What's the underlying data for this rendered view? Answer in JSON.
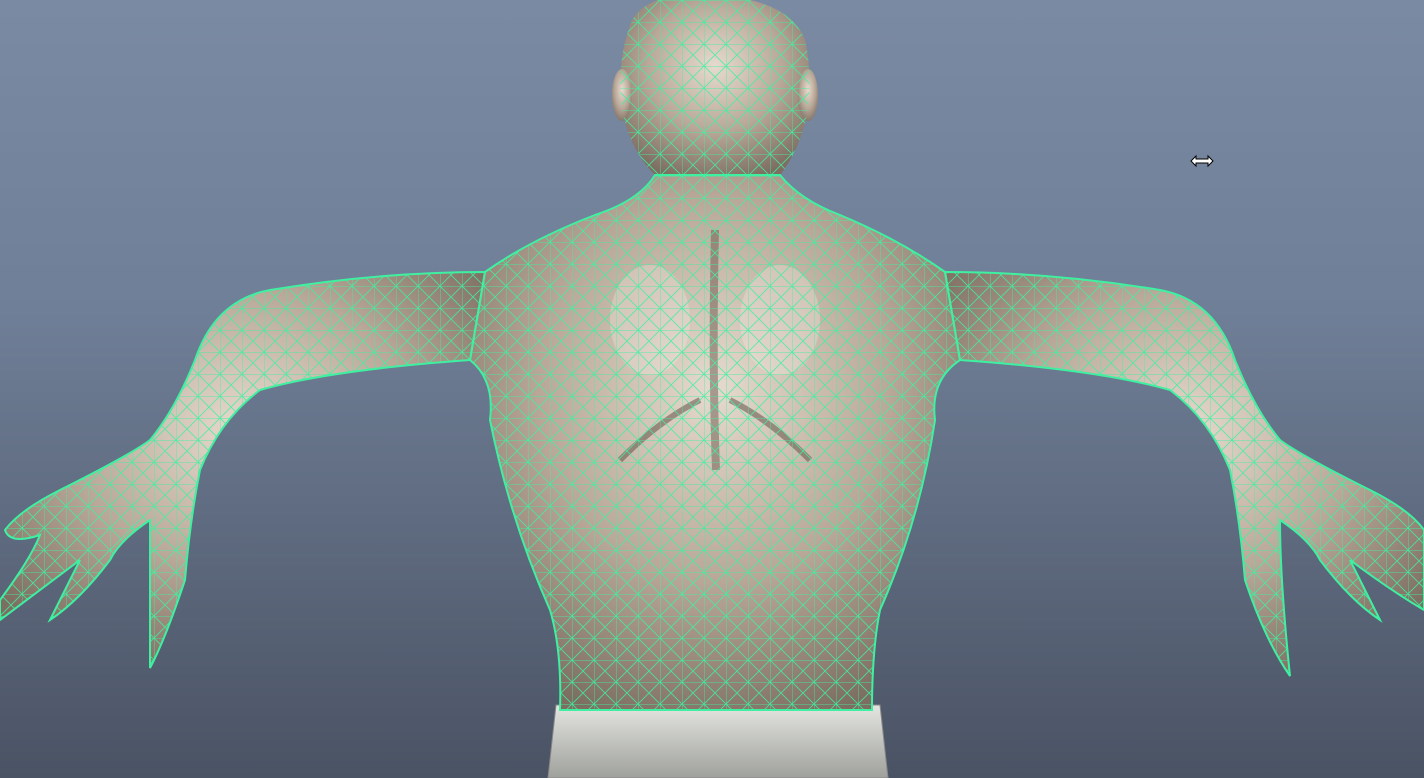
{
  "viewport": {
    "background_top": "#7b8aa3",
    "background_bottom": "#4a5364",
    "wireframe_color": "#3ff0a0",
    "skin_color": "#c9b8a6",
    "pants_color": "#cfd0cc"
  },
  "model": {
    "icon": "character-mesh-icon",
    "display_mode": "wireframe-on-shaded",
    "selected": true
  },
  "cursor": {
    "icon": "resize-horizontal-cursor-icon"
  }
}
